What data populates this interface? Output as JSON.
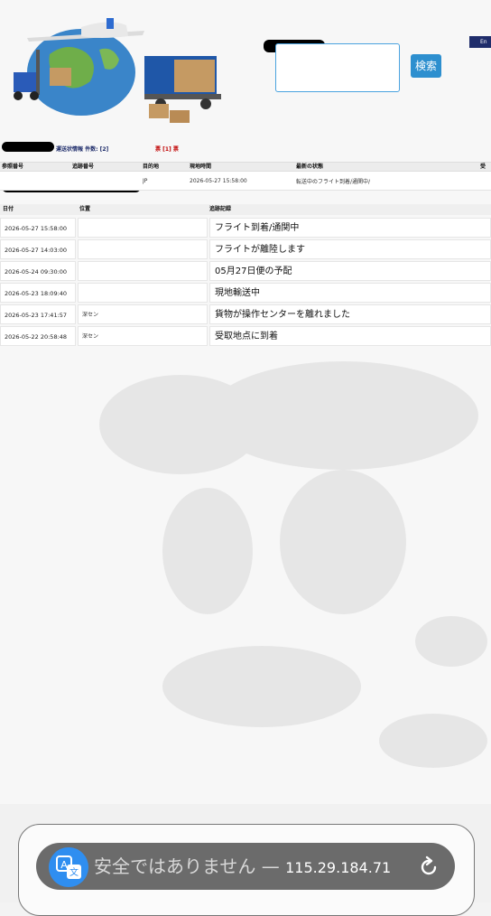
{
  "header": {
    "lang_button": "En",
    "search_button": "検索",
    "search_value": ""
  },
  "info": {
    "title": "運送状情報 件数: [2]",
    "ticket": "票 [1] 票"
  },
  "ref_table": {
    "headers": [
      "参照番号",
      "追跡番号",
      "目的地",
      "現地時間",
      "最新の状態",
      "受"
    ],
    "row": [
      "",
      "",
      "JP",
      "2026-05-27 15:58:00",
      "転送中のフライト到着/通関中/",
      ""
    ]
  },
  "events": {
    "headers": [
      "日付",
      "位置",
      "追跡記録"
    ],
    "rows": [
      {
        "date": "2026-05-27 15:58:00",
        "location": "",
        "record": "フライト到着/通関中"
      },
      {
        "date": "2026-05-27 14:03:00",
        "location": "",
        "record": "フライトが離陸します"
      },
      {
        "date": "2026-05-24 09:30:00",
        "location": "",
        "record": "05月27日便の予配"
      },
      {
        "date": "2026-05-23 18:09:40",
        "location": "",
        "record": "現地輸送中"
      },
      {
        "date": "2026-05-23 17:41:57",
        "location": "深セン",
        "record": "貨物が操作センターを離れました"
      },
      {
        "date": "2026-05-22 20:58:48",
        "location": "深セン",
        "record": "受取地点に到着"
      }
    ]
  },
  "browser": {
    "security_text": "安全ではありません —",
    "ip": "115.29.184.71",
    "icons": [
      "translate-icon",
      "reload-icon"
    ]
  },
  "colors": {
    "accent": "#2d8fcf",
    "navy": "#1f2d6b",
    "alert": "#c00000"
  }
}
